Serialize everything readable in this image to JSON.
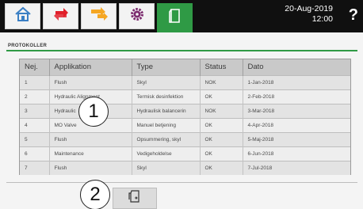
{
  "tabs": [
    {
      "icon": "home-icon"
    },
    {
      "icon": "flush-arrows-icon"
    },
    {
      "icon": "balance-arrows-icon"
    },
    {
      "icon": "settings-gear-icon"
    },
    {
      "icon": "protocol-export-icon",
      "active": true
    }
  ],
  "header": {
    "date": "20-Aug-2019",
    "time": "12:00",
    "help_label": "?"
  },
  "section": {
    "title": "PROTOKOLLER"
  },
  "table": {
    "columns": [
      "Nej.",
      "Applikation",
      "Type",
      "Status",
      "Dato"
    ],
    "rows": [
      [
        "1",
        "Flush",
        "Skyl",
        "NOK",
        "1-Jan-2018"
      ],
      [
        "2",
        "Hydraulic Alignment",
        "Termisk desinfektion",
        "OK",
        "2-Feb-2018"
      ],
      [
        "3",
        "Hydraulic",
        "Hydraulisk balancerin",
        "NOK",
        "3-Mar-2018"
      ],
      [
        "4",
        "MO Valve",
        "Manuel betjening",
        "OK",
        "4-Apr-2018"
      ],
      [
        "5",
        "Flush",
        "Opsummering, skyl",
        "OK",
        "5-Maj-2018"
      ],
      [
        "6",
        "Maintenance",
        "Vedigeholdelse",
        "OK",
        "6-Jun-2018"
      ],
      [
        "7",
        "Flush",
        "Skyl",
        "OK",
        "7-Jul-2018"
      ]
    ]
  },
  "callouts": {
    "one": "1",
    "two": "2"
  },
  "colors": {
    "topbar": "#101010",
    "accent": "#2f9a45",
    "flush_icon": "#e0202a",
    "balance_icon": "#f5a623",
    "gear_icon": "#7b2a6e"
  }
}
